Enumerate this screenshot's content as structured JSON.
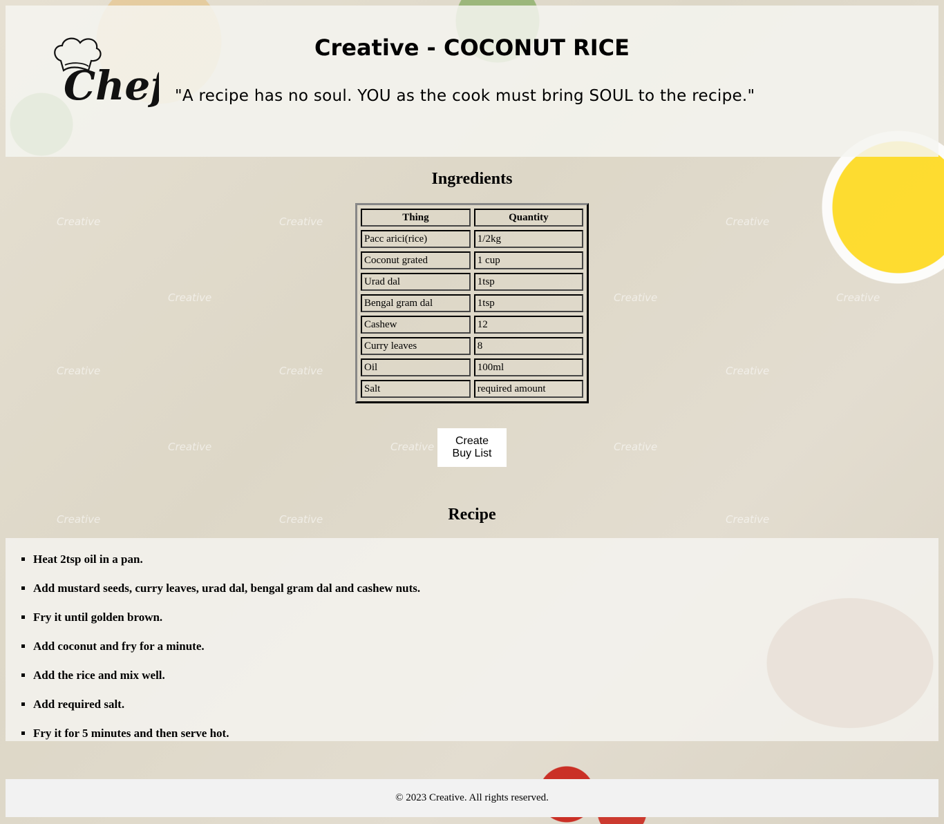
{
  "header": {
    "title": "Creative - COCONUT RICE",
    "quote": "\"A recipe has no soul. YOU as the cook must bring SOUL to the recipe.\"",
    "logo_text": "Chef"
  },
  "ingredients": {
    "heading": "Ingredients",
    "columns": [
      "Thing",
      "Quantity"
    ],
    "rows": [
      [
        "Pacc arici(rice)",
        "1/2kg"
      ],
      [
        "Coconut grated",
        "1 cup"
      ],
      [
        "Urad dal",
        "1tsp"
      ],
      [
        "Bengal gram dal",
        "1tsp"
      ],
      [
        "Cashew",
        "12"
      ],
      [
        "Curry leaves",
        "8"
      ],
      [
        "Oil",
        "100ml"
      ],
      [
        "Salt",
        "required amount"
      ]
    ]
  },
  "buy_button": {
    "line1": "Create",
    "line2": "Buy List"
  },
  "recipe": {
    "heading": "Recipe",
    "steps": [
      "Heat 2tsp oil in a pan.",
      "Add mustard seeds, curry leaves, urad dal, bengal gram dal and cashew nuts.",
      "Fry it until golden brown.",
      "Add coconut and fry for a minute.",
      "Add the rice and mix well.",
      "Add required salt.",
      "Fry it for 5 minutes and then serve hot."
    ]
  },
  "footer": {
    "text": "© 2023 Creative. All rights reserved."
  },
  "watermark": "Creative"
}
